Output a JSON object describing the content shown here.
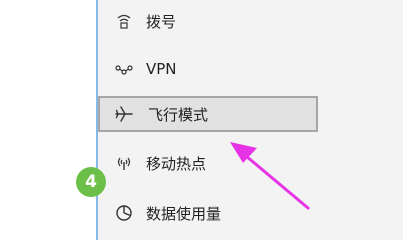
{
  "menu": {
    "items": [
      {
        "label": "拨号",
        "icon": "dialup-icon"
      },
      {
        "label": "VPN",
        "icon": "vpn-icon"
      },
      {
        "label": "飞行模式",
        "icon": "airplane-icon",
        "selected": true
      },
      {
        "label": "移动热点",
        "icon": "hotspot-icon"
      },
      {
        "label": "数据使用量",
        "icon": "data-usage-icon"
      }
    ]
  },
  "step_badge": "4",
  "colors": {
    "panel_background": "#f3f3f3",
    "selected_item": "#e1e1e1",
    "annotation_arrow": "#e633e6",
    "step_badge": "#6cc04a",
    "divider": "#8ab8e8"
  }
}
